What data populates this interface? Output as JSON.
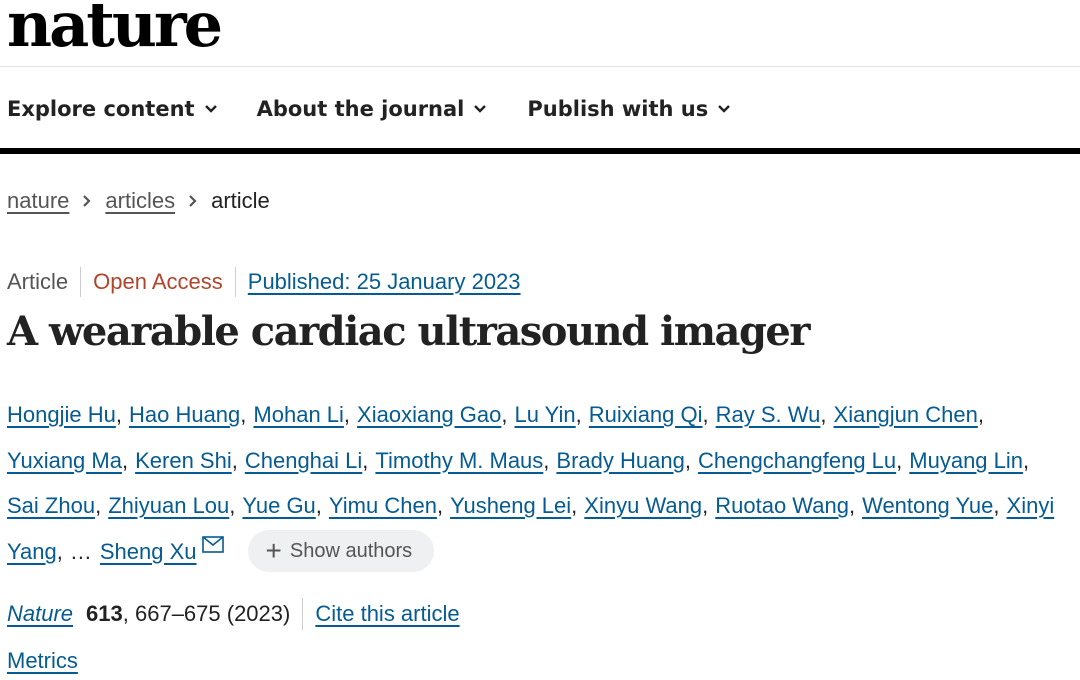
{
  "site": {
    "logo": "nature"
  },
  "nav": {
    "items": [
      {
        "label": "Explore content",
        "icon": "chevron-down-icon"
      },
      {
        "label": "About the journal",
        "icon": "chevron-down-icon"
      },
      {
        "label": "Publish with us",
        "icon": "chevron-down-icon"
      }
    ]
  },
  "breadcrumb": {
    "items": [
      "nature",
      "articles"
    ],
    "current": "article",
    "separator_icon": "chevron-right-icon"
  },
  "article": {
    "type": "Article",
    "access": "Open Access",
    "published": "Published: 25 January 2023",
    "title": "A wearable cardiac ultrasound imager",
    "authors_line1": [
      "Hongjie Hu",
      "Hao Huang",
      "Mohan Li",
      "Xiaoxiang Gao",
      "Lu Yin",
      "Ruixiang Qi",
      "Ray S. Wu",
      "Xiangjun Chen"
    ],
    "authors_line2": [
      "Yuxiang Ma",
      "Keren Shi",
      "Chenghai Li",
      "Timothy M. Maus",
      "Brady Huang",
      "Chengchangfeng Lu",
      "Muyang Lin"
    ],
    "authors_line3": [
      "Sai Zhou",
      "Zhiyuan Lou",
      "Yue Gu",
      "Yimu Chen",
      "Yusheng Lei",
      "Xinyu Wang",
      "Ruotao Wang",
      "Wentong Yue",
      "Xinyi"
    ],
    "authors_line4_first": "Yang",
    "ellipsis": "…",
    "corresponding_author": "Sheng Xu",
    "mail_icon": "mail-icon",
    "show_authors_label": "Show authors",
    "show_authors_icon": "plus-icon",
    "journal": "Nature",
    "volume": "613",
    "pages": ", 667–675 (2023)",
    "cite_label": "Cite this article",
    "metrics_label": "Metrics"
  },
  "colors": {
    "link": "#055b92",
    "open_access": "#b0452c",
    "text": "#222222",
    "muted": "#555555"
  }
}
